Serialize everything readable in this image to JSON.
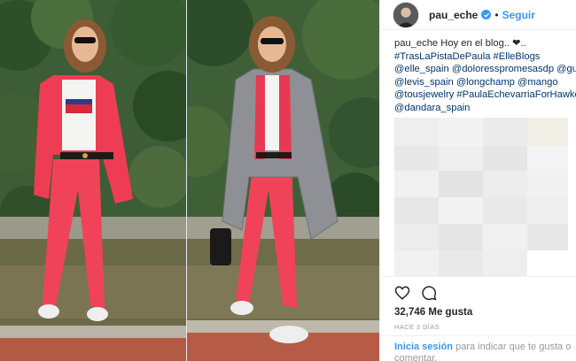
{
  "post": {
    "username": "pau_eche",
    "separator": "•",
    "follow_label": "Seguir",
    "icons": {
      "verified": "verified-badge-icon",
      "like": "heart-icon",
      "comment": "comment-icon"
    }
  },
  "caption": {
    "username": "pau_eche",
    "lines": [
      "Hoy en el blog.. ❤..",
      "#TrasLaPistaDePaula #ElleBlogs",
      "@elle_spain @doloresspromesasdp @gucci",
      "@levis_spain @longchamp @mango",
      "@tousjewelry #PaulaEchevarriaForHawkers",
      "@dandara_spain"
    ]
  },
  "engagement": {
    "likes": "32,746 Me gusta",
    "time": "HACE 3 DÍAS"
  },
  "login": {
    "link": "Inicia sesión",
    "text": "para indicar que te gusta o comentar."
  },
  "photo": {
    "shirt_logo": "levi's",
    "colors": {
      "foliage": "#2f5a2a",
      "suit_red": "#f0435a",
      "coat_grey": "#8d8f94"
    }
  }
}
